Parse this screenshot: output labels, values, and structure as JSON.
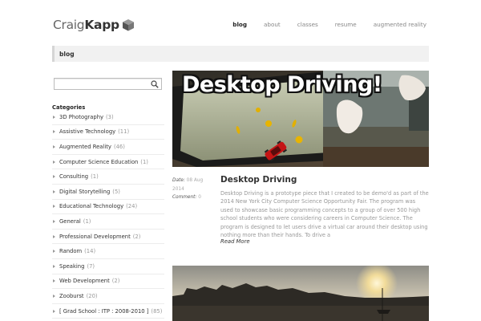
{
  "header": {
    "logo_part1": "Craig",
    "logo_part2": "Kapp",
    "nav": [
      {
        "label": "blog"
      },
      {
        "label": "about"
      },
      {
        "label": "classes"
      },
      {
        "label": "resume"
      },
      {
        "label": "augmented reality"
      }
    ]
  },
  "page_title": "blog",
  "search": {
    "value": "",
    "placeholder": ""
  },
  "sidebar": {
    "heading": "Categories",
    "categories": [
      {
        "label": "3D Photography",
        "count": "(3)"
      },
      {
        "label": "Assistive Technology",
        "count": "(11)"
      },
      {
        "label": "Augmented Reality",
        "count": "(46)"
      },
      {
        "label": "Computer Science Education",
        "count": "(1)"
      },
      {
        "label": "Consulting",
        "count": "(1)"
      },
      {
        "label": "Digital Storytelling",
        "count": "(5)"
      },
      {
        "label": "Educational Technology",
        "count": "(24)"
      },
      {
        "label": "General",
        "count": "(1)"
      },
      {
        "label": "Professional Development",
        "count": "(2)"
      },
      {
        "label": "Random",
        "count": "(14)"
      },
      {
        "label": "Speaking",
        "count": "(7)"
      },
      {
        "label": "Web Development",
        "count": "(2)"
      },
      {
        "label": "Zooburst",
        "count": "(20)"
      },
      {
        "label": "[ Grad School : ITP : 2008-2010 ]",
        "count": "(85)"
      }
    ]
  },
  "post": {
    "image_headline": "Desktop Driving!",
    "date_label": "Date:",
    "date": "08 Aug 2014",
    "comment_label": "Comment:",
    "comments": "0",
    "title": "Desktop Driving",
    "excerpt": "Desktop Driving is a prototype piece that I created to be demo'd as part of the 2014 New York City Computer Science Opportunity Fair.  The program was used to showcase basic programming concepts to a group of over 500 high school students who were considering careers in Computer Science. The program is designed to let users drive a virtual car around their desktop using nothing more than their hands. To drive a",
    "read_more": "Read More"
  },
  "colors": {
    "titlebar_bg": "#f1f1f1",
    "text_dark": "#333333",
    "text_muted": "#999999"
  }
}
